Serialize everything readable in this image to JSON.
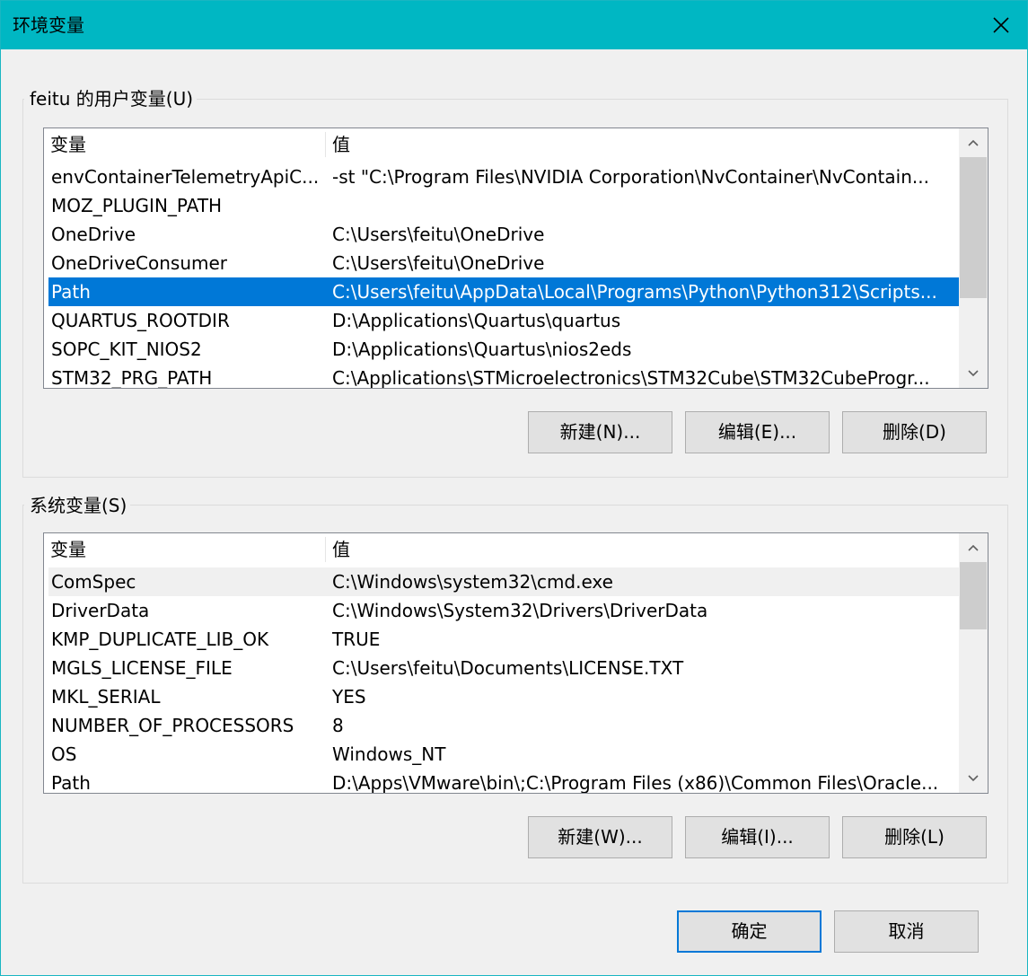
{
  "window": {
    "title": "环境变量",
    "accent_color": "#00b7c3",
    "close_icon": "close-icon"
  },
  "user_vars": {
    "group_label": "feitu 的用户变量(U)",
    "columns": [
      "变量",
      "值"
    ],
    "rows": [
      {
        "name": "envContainerTelemetryApiC...",
        "value": "-st \"C:\\Program Files\\NVIDIA Corporation\\NvContainer\\NvContain..."
      },
      {
        "name": "MOZ_PLUGIN_PATH",
        "value": ""
      },
      {
        "name": "OneDrive",
        "value": "C:\\Users\\feitu\\OneDrive"
      },
      {
        "name": "OneDriveConsumer",
        "value": "C:\\Users\\feitu\\OneDrive"
      },
      {
        "name": "Path",
        "value": "C:\\Users\\feitu\\AppData\\Local\\Programs\\Python\\Python312\\Scripts..."
      },
      {
        "name": "QUARTUS_ROOTDIR",
        "value": "D:\\Applications\\Quartus\\quartus"
      },
      {
        "name": "SOPC_KIT_NIOS2",
        "value": "D:\\Applications\\Quartus\\nios2eds"
      },
      {
        "name": "STM32_PRG_PATH",
        "value": "C:\\Applications\\STMicroelectronics\\STM32Cube\\STM32CubeProgr..."
      }
    ],
    "selected_row": "Path",
    "buttons": {
      "new": "新建(N)...",
      "edit": "编辑(E)...",
      "delete": "删除(D)"
    }
  },
  "system_vars": {
    "group_label": "系统变量(S)",
    "columns": [
      "变量",
      "值"
    ],
    "rows": [
      {
        "name": "ComSpec",
        "value": "C:\\Windows\\system32\\cmd.exe"
      },
      {
        "name": "DriverData",
        "value": "C:\\Windows\\System32\\Drivers\\DriverData"
      },
      {
        "name": "KMP_DUPLICATE_LIB_OK",
        "value": "TRUE"
      },
      {
        "name": "MGLS_LICENSE_FILE",
        "value": "C:\\Users\\feitu\\Documents\\LICENSE.TXT"
      },
      {
        "name": "MKL_SERIAL",
        "value": "YES"
      },
      {
        "name": "NUMBER_OF_PROCESSORS",
        "value": "8"
      },
      {
        "name": "OS",
        "value": "Windows_NT"
      },
      {
        "name": "Path",
        "value": "D:\\Apps\\VMware\\bin\\;C:\\Program Files (x86)\\Common Files\\Oracle..."
      }
    ],
    "buttons": {
      "new": "新建(W)...",
      "edit": "编辑(I)...",
      "delete": "删除(L)"
    }
  },
  "footer": {
    "ok": "确定",
    "cancel": "取消"
  },
  "colors": {
    "selection": "#0078d7",
    "titlebar": "#00b7c3"
  }
}
